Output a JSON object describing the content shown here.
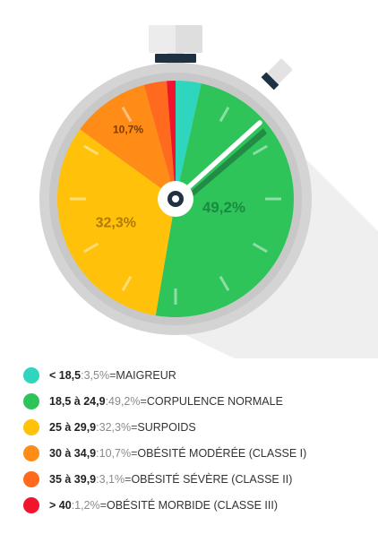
{
  "chart_data": {
    "type": "pie",
    "title": "",
    "style": "stopwatch",
    "slices": [
      {
        "range": "< 18,5",
        "value": 3.5,
        "percent_label": "3,5%",
        "category": "MAIGREUR",
        "color": "#2ED6BD",
        "slice_label": ""
      },
      {
        "range": "18,5 à 24,9",
        "value": 49.2,
        "percent_label": "49,2%",
        "category": "CORPULENCE NORMALE",
        "color": "#2EC45A",
        "slice_label": "49,2%"
      },
      {
        "range": "25 à 29,9",
        "value": 32.3,
        "percent_label": "32,3%",
        "category": "SURPOIDS",
        "color": "#FFC109",
        "slice_label": "32,3%"
      },
      {
        "range": "30 à 34,9",
        "value": 10.7,
        "percent_label": "10,7%",
        "category": "OBÉSITÉ MODÉRÉE (CLASSE I)",
        "color": "#FF8C16",
        "slice_label": "10,7%"
      },
      {
        "range": "35 à 39,9",
        "value": 3.1,
        "percent_label": "3,1%",
        "category": "OBÉSITÉ SÉVÈRE (CLASSE II)",
        "color": "#FF6A1E",
        "slice_label": ""
      },
      {
        "range": "> 40",
        "value": 1.2,
        "percent_label": "1,2%",
        "category": "OBÉSITÉ MORBIDE (CLASSE III)",
        "color": "#F2132C",
        "slice_label": ""
      }
    ]
  },
  "legend": {
    "separator": " : ",
    "equals": " = "
  },
  "colors": {
    "watch_body": "#D4D4D4",
    "watch_dark": "#1F3243",
    "watch_top": "#EDEDED",
    "hand": "#FFFFFF",
    "shadow": "#EFEFEF"
  }
}
